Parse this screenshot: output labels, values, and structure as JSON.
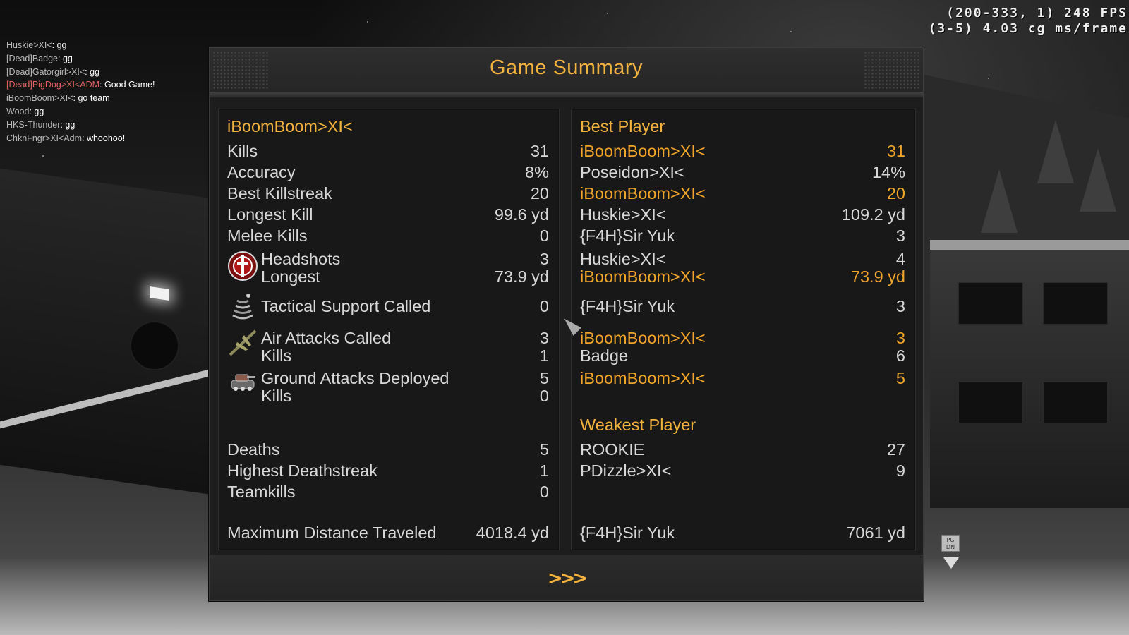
{
  "hud": {
    "fps_line1": "(200-333, 1) 248 FPS",
    "fps_line2": "(3-5) 4.03 cg ms/frame"
  },
  "chat": [
    {
      "who": "Huskie>XI<",
      "msg": "gg",
      "dead": false
    },
    {
      "who": "[Dead]Badge",
      "msg": "gg",
      "dead": false
    },
    {
      "who": "[Dead]Gatorgirl>XI<",
      "msg": "gg",
      "dead": false
    },
    {
      "who": "[Dead]PigDog>XI<ADM",
      "msg": "Good Game!",
      "dead": true
    },
    {
      "who": "iBoomBoom>XI<",
      "msg": "go team",
      "dead": false
    },
    {
      "who": "Wood",
      "msg": "gg",
      "dead": false
    },
    {
      "who": "HKS-Thunder",
      "msg": "gg",
      "dead": false
    },
    {
      "who": "ChknFngr>XI<Adm",
      "msg": "whoohoo!",
      "dead": false
    }
  ],
  "summary": {
    "title": "Game Summary",
    "next_label": ">>>",
    "player_name": "iBoomBoom>XI<",
    "best_player_header": "Best Player",
    "weakest_player_header": "Weakest Player",
    "left": {
      "kills": {
        "label": "Kills",
        "value": "31"
      },
      "accuracy": {
        "label": "Accuracy",
        "value": "8%"
      },
      "best_killstreak": {
        "label": "Best Killstreak",
        "value": "20"
      },
      "longest_kill": {
        "label": "Longest Kill",
        "value": "99.6 yd"
      },
      "melee_kills": {
        "label": "Melee Kills",
        "value": "0"
      },
      "headshots": {
        "label": "Headshots",
        "value": "3"
      },
      "headshots_longest": {
        "label": "Longest",
        "value": "73.9 yd"
      },
      "tactical": {
        "label": "Tactical Support Called",
        "value": "0"
      },
      "air_attacks": {
        "label": "Air Attacks Called",
        "value": "3"
      },
      "air_kills": {
        "label": "Kills",
        "value": "1"
      },
      "ground_attacks": {
        "label": "Ground Attacks Deployed",
        "value": "5"
      },
      "ground_kills": {
        "label": "Kills",
        "value": "0"
      },
      "deaths": {
        "label": "Deaths",
        "value": "5"
      },
      "highest_deathstreak": {
        "label": "Highest Deathstreak",
        "value": "1"
      },
      "teamkills": {
        "label": "Teamkills",
        "value": "0"
      },
      "max_distance": {
        "label": "Maximum Distance Traveled",
        "value": "4018.4 yd"
      }
    },
    "right": {
      "kills": {
        "player": "iBoomBoom>XI<",
        "value": "31"
      },
      "accuracy": {
        "player": "Poseidon>XI<",
        "value": "14%"
      },
      "best_killstreak": {
        "player": "iBoomBoom>XI<",
        "value": "20"
      },
      "longest_kill": {
        "player": "Huskie>XI<",
        "value": "109.2 yd"
      },
      "melee_kills": {
        "player": "{F4H}Sir Yuk",
        "value": "3"
      },
      "headshots": {
        "player": "Huskie>XI<",
        "value": "4"
      },
      "headshots_longest": {
        "player": "iBoomBoom>XI<",
        "value": "73.9 yd"
      },
      "tactical": {
        "player": "{F4H}Sir Yuk",
        "value": "3"
      },
      "air_attacks": {
        "player": "iBoomBoom>XI<",
        "value": "3"
      },
      "air_kills": {
        "player": "Badge",
        "value": "6"
      },
      "ground_attacks": {
        "player": "iBoomBoom>XI<",
        "value": "5"
      },
      "deaths": {
        "player": "ROOKIE",
        "value": "27"
      },
      "highest_deathstreak": {
        "player": "PDizzle>XI<",
        "value": "9"
      },
      "max_distance": {
        "player": "{F4H}Sir Yuk",
        "value": "7061 yd"
      }
    },
    "icons": {
      "headshots": "crosshair-emblem-icon",
      "tactical": "radar-sweep-icon",
      "air": "aircraft-icon",
      "ground": "tank-icon"
    }
  },
  "pgdn_label_1": "PG",
  "pgdn_label_2": "DN",
  "colors": {
    "accent": "#f3b23d",
    "highlight": "#f0a42a",
    "text": "#d8d8d8"
  }
}
